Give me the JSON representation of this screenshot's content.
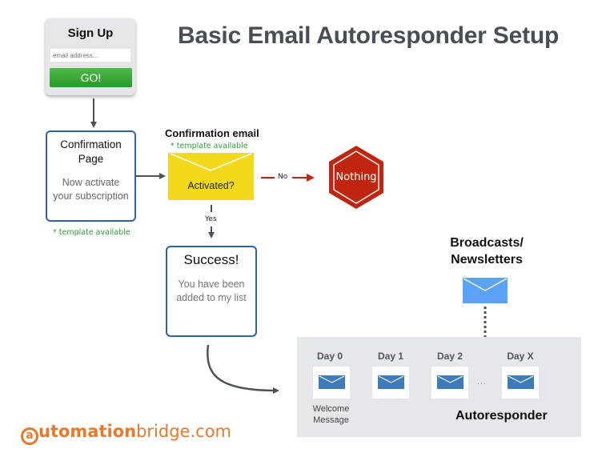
{
  "title": "Basic Email Autoresponder Setup",
  "signup_form": {
    "heading": "Sign Up",
    "email_placeholder": "email address...",
    "submit_label": "GO!"
  },
  "confirmation_page": {
    "heading_line1": "Confirmation",
    "heading_line2": "Page",
    "body_line1": "Now activate",
    "body_line2": "your subscription",
    "template_note": "* template available"
  },
  "confirmation_email": {
    "heading": "Confirmation email",
    "template_note": "* template available",
    "question": "Activated?"
  },
  "branches": {
    "no_label": "No",
    "yes_label": "Yes"
  },
  "nothing_node": {
    "label": "Nothing",
    "color": "#c0260f"
  },
  "success_page": {
    "heading": "Success!",
    "body_line1": "You have been",
    "body_line2": "added to my list"
  },
  "broadcasts": {
    "line1": "Broadcasts/",
    "line2": "Newsletters"
  },
  "autoresponder": {
    "label": "Autoresponder",
    "days": [
      {
        "label": "Day 0"
      },
      {
        "label": "Day 1"
      },
      {
        "label": "Day 2"
      },
      {
        "label": "Day X"
      }
    ],
    "ellipsis": "...",
    "welcome_line1": "Welcome",
    "welcome_line2": "Message"
  },
  "logo": {
    "at_symbol": "a",
    "part1": "utomation",
    "part2": "bridge",
    "part3": ".com"
  },
  "colors": {
    "box_border": "#2f5fb0",
    "yellow_envelope": "#f2d91c",
    "blue_envelope": "#5aa3f5",
    "day_envelope": "#3d7cb6",
    "template_green": "#2e9a3a",
    "brand_orange": "#e8782a",
    "arrow_gray": "#4d5157",
    "arrow_red": "#c0260f"
  }
}
